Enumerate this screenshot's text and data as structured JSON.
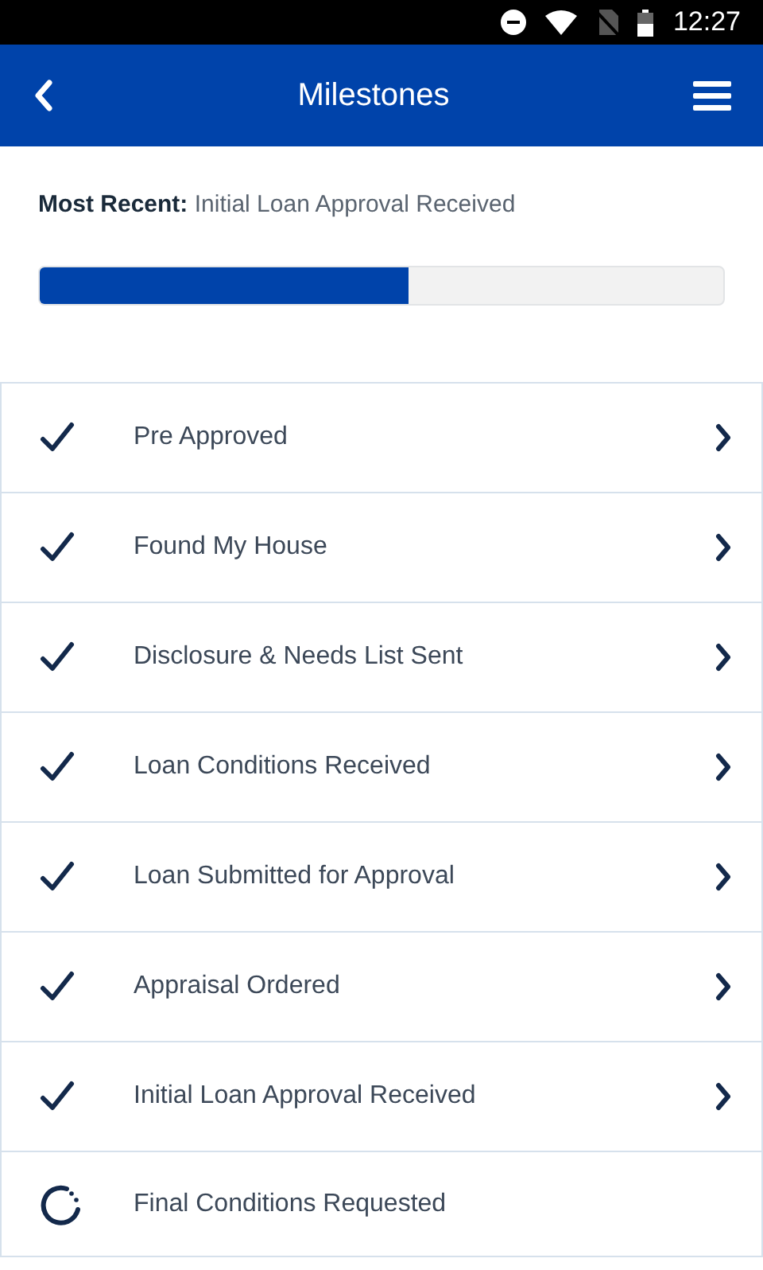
{
  "status_bar": {
    "time": "12:27"
  },
  "header": {
    "title": "Milestones"
  },
  "most_recent": {
    "label": "Most Recent:",
    "value": "Initial Loan Approval Received"
  },
  "progress": {
    "level": 0.54
  },
  "milestones": [
    {
      "label": "Pre Approved",
      "kind": "done"
    },
    {
      "label": "Found My House",
      "kind": "done"
    },
    {
      "label": "Disclosure & Needs List Sent",
      "kind": "done"
    },
    {
      "label": "Loan Conditions Received",
      "kind": "done"
    },
    {
      "label": "Loan Submitted for Approval",
      "kind": "done"
    },
    {
      "label": "Appraisal Ordered",
      "kind": "done"
    },
    {
      "label": "Initial Loan Approval Received",
      "kind": "done"
    },
    {
      "label": "Final Conditions Requested",
      "kind": "pending"
    }
  ]
}
